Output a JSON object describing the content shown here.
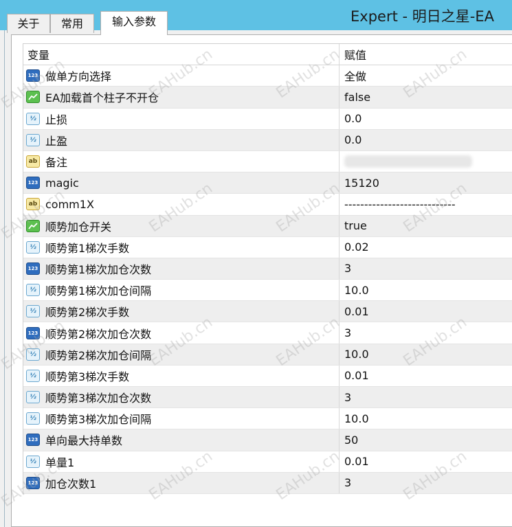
{
  "window": {
    "title": "Expert - 明日之星-EA"
  },
  "tabs": [
    {
      "label": "关于"
    },
    {
      "label": "常用"
    },
    {
      "label": "输入参数"
    }
  ],
  "table": {
    "headers": {
      "variable": "变量",
      "value": "赋值"
    },
    "rows": [
      {
        "icon": "int-type-icon",
        "name": "做单方向选择",
        "value": "全做"
      },
      {
        "icon": "bool-type-icon",
        "name": "EA加载首个柱子不开仓",
        "value": "false"
      },
      {
        "icon": "double-type-icon",
        "name": "止损",
        "value": "0.0"
      },
      {
        "icon": "double-type-icon",
        "name": "止盈",
        "value": "0.0"
      },
      {
        "icon": "string-type-icon",
        "name": "备注",
        "value": ""
      },
      {
        "icon": "int-type-icon",
        "name": "magic",
        "value": "15120"
      },
      {
        "icon": "string-type-icon",
        "name": "comm1X",
        "value": "----------------------------"
      },
      {
        "icon": "bool-type-icon",
        "name": "顺势加仓开关",
        "value": "true"
      },
      {
        "icon": "double-type-icon",
        "name": "顺势第1梯次手数",
        "value": "0.02"
      },
      {
        "icon": "int-type-icon",
        "name": "顺势第1梯次加仓次数",
        "value": "3"
      },
      {
        "icon": "double-type-icon",
        "name": "顺势第1梯次加仓间隔",
        "value": "10.0"
      },
      {
        "icon": "double-type-icon",
        "name": "顺势第2梯次手数",
        "value": "0.01"
      },
      {
        "icon": "int-type-icon",
        "name": "顺势第2梯次加仓次数",
        "value": "3"
      },
      {
        "icon": "double-type-icon",
        "name": "顺势第2梯次加仓间隔",
        "value": "10.0"
      },
      {
        "icon": "double-type-icon",
        "name": "顺势第3梯次手数",
        "value": "0.01"
      },
      {
        "icon": "double-type-icon",
        "name": "顺势第3梯次加仓次数",
        "value": "3"
      },
      {
        "icon": "double-type-icon",
        "name": "顺势第3梯次加仓间隔",
        "value": "10.0"
      },
      {
        "icon": "int-type-icon",
        "name": "单向最大持单数",
        "value": "50"
      },
      {
        "icon": "double-type-icon",
        "name": "单量1",
        "value": "0.01"
      },
      {
        "icon": "int-type-icon",
        "name": "加仓次数1",
        "value": "3"
      }
    ]
  },
  "watermark": "EAHub.cn",
  "colors": {
    "titlebar": "#5ec1e4",
    "row_alt": "#eeeeee"
  }
}
